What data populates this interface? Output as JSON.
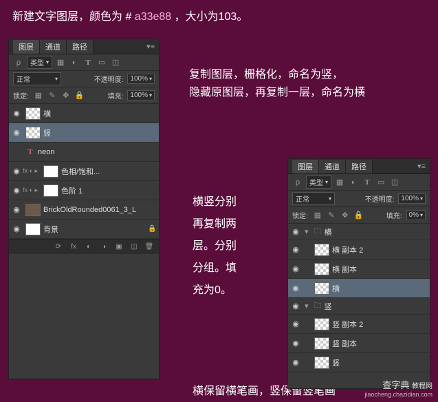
{
  "title": {
    "pre": "新建文字图层，颜色为 # ",
    "color": "a33e88",
    "post": " ，大小为103。"
  },
  "note1": {
    "l1": "复制图层，栅格化，命名为竖，",
    "l2": "隐藏原图层，再复制一层，命名为横"
  },
  "note2": {
    "l1": "横竖分别",
    "l2": "再复制两",
    "l3": "层。分别",
    "l4": "分组。填",
    "l5": "充为0。"
  },
  "note3": "横保留横笔画，竖保留竖笔画",
  "watermark": {
    "name": "查字典",
    "sub": "教程网",
    "url": "jiaocheng.chazidian.com"
  },
  "common": {
    "tabs": [
      "图层",
      "通道",
      "路径"
    ],
    "kind": "类型",
    "blend": "正常",
    "opacity_lbl": "不透明度:",
    "lock_lbl": "锁定:",
    "fill_lbl": "填充:",
    "pct100": "100%"
  },
  "panel1": {
    "fill": "100%",
    "layers": [
      {
        "name": "横",
        "checker": true
      },
      {
        "name": "竖",
        "checker": true,
        "selected": true
      },
      {
        "name": "neon",
        "type": "text",
        "hidden": true
      },
      {
        "name": "色相/饱和...",
        "fx": true,
        "white": true
      },
      {
        "name": "色阶 1",
        "fx": true,
        "white": true
      },
      {
        "name": "BrickOldRounded0061_3_L",
        "brick": true
      },
      {
        "name": "背景",
        "white": true,
        "locked": true
      }
    ]
  },
  "panel2": {
    "fill": "0%",
    "groups": [
      {
        "name": "横",
        "items": [
          "横 副本 2",
          "横 副本",
          "横"
        ],
        "selIndex": 2
      },
      {
        "name": "竖",
        "items": [
          "竖 副本 2",
          "竖 副本",
          "竖"
        ]
      }
    ]
  }
}
